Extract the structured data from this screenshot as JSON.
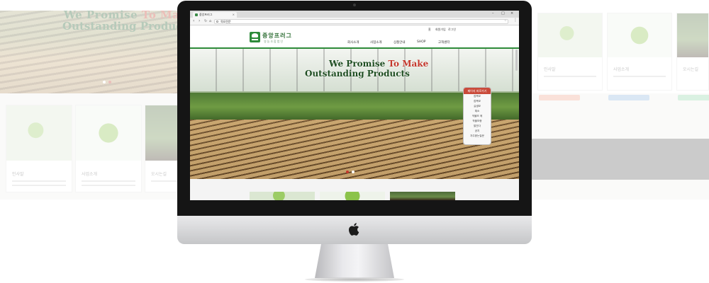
{
  "background_site": {
    "hero_line1": "We Promise",
    "hero_line1_red": "To Make",
    "hero_line2": "Outstanding Products",
    "cards": [
      {
        "title": "인사말"
      },
      {
        "title": "사업소개"
      },
      {
        "title": "오시는길"
      }
    ],
    "right_cards": [
      {
        "title": "인사말"
      },
      {
        "title": "사업소개"
      },
      {
        "title": "오시는길"
      }
    ]
  },
  "browser": {
    "tab_title": "중앙프러그",
    "url": "육묘전문",
    "window_controls": [
      "–",
      "□",
      "×"
    ]
  },
  "site": {
    "logo_text": "중앙프러그",
    "logo_sub": "영농조합법인",
    "utility_links": [
      "홈",
      "회원가입",
      "로그인"
    ],
    "nav": [
      "회사소개",
      "사업소개",
      "상품안내",
      "SHOP",
      "고객센터"
    ],
    "hero_line1": "We Promise",
    "hero_line1_red": "To Make",
    "hero_line2": "Outstanding Products",
    "quick_menu": {
      "title": "페이지 바로가기",
      "items": [
        "접목묘",
        "접목묘",
        "실생묘",
        "채소",
        "작물모 메",
        "작물모종",
        "발안다",
        "공지",
        "자주묻는질문"
      ]
    }
  },
  "colors": {
    "brand_green": "#2e8b3a",
    "accent_red": "#c4372b",
    "bezel": "#151515"
  }
}
